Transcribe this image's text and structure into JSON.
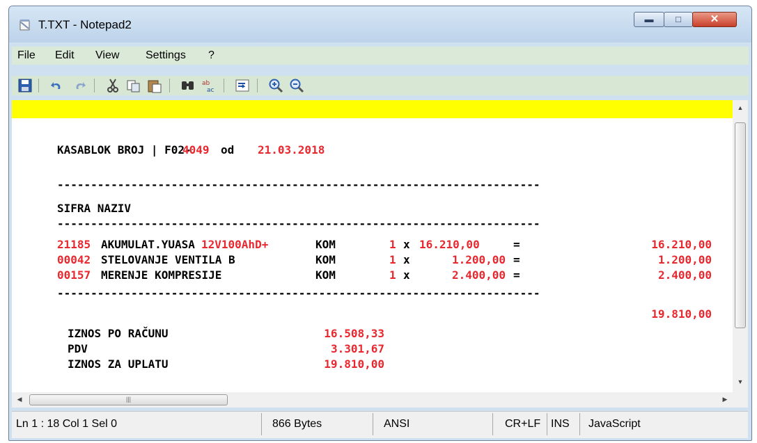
{
  "window": {
    "title": "T.TXT - Notepad2",
    "minimize": "▬",
    "maximize": "□",
    "close": "✕",
    "icon": "notepad-icon"
  },
  "menu": [
    "File",
    "Edit",
    "View",
    "Settings",
    "?"
  ],
  "toolbar": {
    "icons": [
      "save-icon",
      "undo-icon",
      "redo-icon",
      "cut-icon",
      "copy-icon",
      "paste-icon",
      "find-icon",
      "replace-icon",
      "wordwrap-icon",
      "zoom-in-icon",
      "zoom-out-icon"
    ]
  },
  "document": {
    "header": {
      "label": "KASABLOK BROJ | F02-",
      "number": "4049",
      "od": "od",
      "date": "21.03.2018"
    },
    "separator": "------------------------------------------------------------------------",
    "columns": "SIFRA NAZIV",
    "items": [
      {
        "code": "21185",
        "name": "AKUMULAT.YUASA",
        "spec": "12V100AhD+",
        "unit": "KOM",
        "qty": "1",
        "x": "x",
        "price": "16.210,00",
        "eq": "=",
        "total": "16.210,00"
      },
      {
        "code": "00042",
        "name": "STELOVANJE VENTILA B",
        "spec": "",
        "unit": "KOM",
        "qty": "1",
        "x": "x",
        "price": "1.200,00",
        "eq": "=",
        "total": "1.200,00"
      },
      {
        "code": "00157",
        "name": "MERENJE KOMPRESIJE",
        "spec": "",
        "unit": "KOM",
        "qty": "1",
        "x": "x",
        "price": "2.400,00",
        "eq": "=",
        "total": "2.400,00"
      }
    ],
    "grand_total": "19.810,00",
    "summary": [
      {
        "label": "IZNOS PO RAČUNU",
        "value": "16.508,33"
      },
      {
        "label": "PDV",
        "value": "3.301,67"
      },
      {
        "label": "IZNOS ZA UPLATU",
        "value": "19.810,00"
      }
    ]
  },
  "statusbar": {
    "position": "Ln 1 : 18  Col 1  Sel 0",
    "size": "866 Bytes",
    "encoding": "ANSI",
    "eol": "CR+LF",
    "mode": "INS",
    "scheme": "JavaScript"
  },
  "colors": {
    "keyword_red": "#e8282e",
    "highlight_line": "#ffff00"
  }
}
